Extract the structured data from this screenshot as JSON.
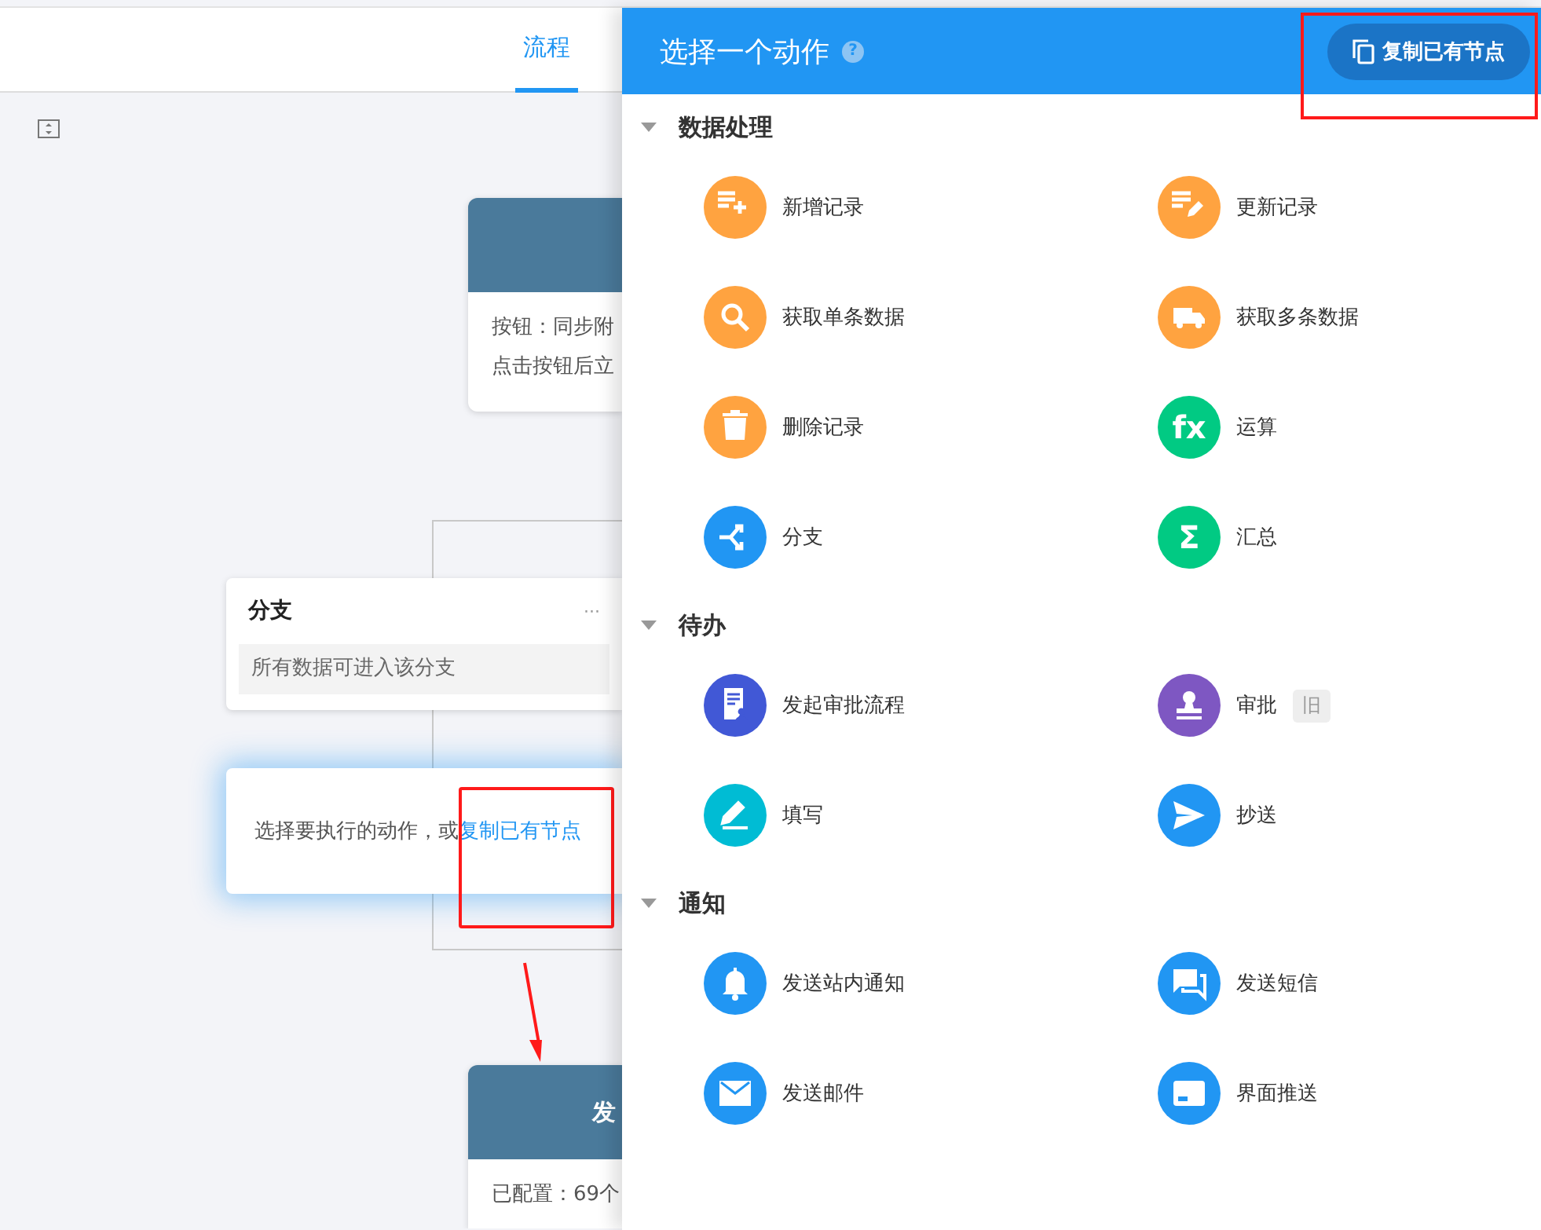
{
  "top_tabs": [
    {
      "label": "流程",
      "selected": true
    }
  ],
  "canvas": {
    "trigger": {
      "line_1": "按钮：同步附",
      "line_2": "点击按钮后立"
    },
    "branch": {
      "title": "分支",
      "menu": "···",
      "condition": "所有数据可进入该分支"
    },
    "placeholder": {
      "text": "选择要执行的动作，或",
      "link": "复制已有节点",
      "selected": true
    },
    "action": {
      "title": "发",
      "line_1": "已配置：69个"
    }
  },
  "panel": {
    "title": "选择一个动作",
    "help": "?",
    "copy_button": "复制已有节点",
    "sections": [
      {
        "title": "数据处理",
        "expanded": true,
        "items": [
          {
            "label": "新增记录",
            "kind": "add-record",
            "color": "#ffa340"
          },
          {
            "label": "更新记录",
            "kind": "edit-record",
            "color": "#ffa340"
          },
          {
            "label": "获取单条数据",
            "kind": "search",
            "color": "#ffa340"
          },
          {
            "label": "获取多条数据",
            "kind": "truck",
            "color": "#ffa340"
          },
          {
            "label": "删除记录",
            "kind": "trash",
            "color": "#ffa340"
          },
          {
            "label": "运算",
            "kind": "text",
            "icon_text": "fx",
            "color": "#01ca83"
          },
          {
            "label": "分支",
            "kind": "branch",
            "color": "#2196f3"
          },
          {
            "label": "汇总",
            "kind": "text",
            "icon_text": "Σ",
            "color": "#01ca83"
          }
        ]
      },
      {
        "title": "待办",
        "expanded": true,
        "items": [
          {
            "label": "发起审批流程",
            "kind": "document",
            "color": "#4158d6"
          },
          {
            "label": "审批",
            "kind": "stamp",
            "color": "#7e57c2",
            "badge": "旧"
          },
          {
            "label": "填写",
            "kind": "pencil",
            "color": "#00bcd4"
          },
          {
            "label": "抄送",
            "kind": "send",
            "color": "#2196f3"
          }
        ]
      },
      {
        "title": "通知",
        "expanded": true,
        "items": [
          {
            "label": "发送站内通知",
            "kind": "bell",
            "color": "#2196f3"
          },
          {
            "label": "发送短信",
            "kind": "chat",
            "color": "#2196f3"
          },
          {
            "label": "发送邮件",
            "kind": "mail",
            "color": "#2196f3"
          },
          {
            "label": "界面推送",
            "kind": "screen",
            "color": "#2196f3"
          }
        ]
      }
    ]
  }
}
